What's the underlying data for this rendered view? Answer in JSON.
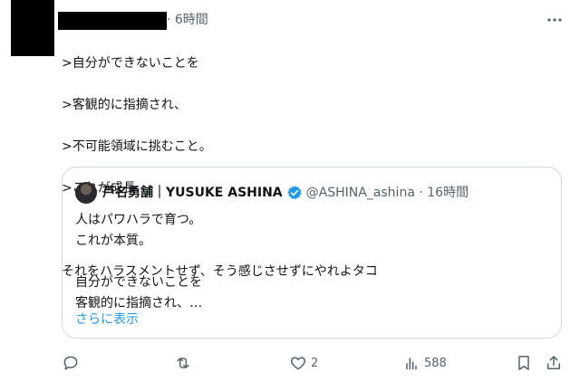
{
  "tweet": {
    "time": "· 6時間",
    "lines": [
      ">自分ができないことを",
      ">客観的に指摘され、",
      ">不可能領域に挑むこと。",
      ">これが成長",
      "",
      "それをハラスメントせず、そう感じさせずにやれよタコ"
    ]
  },
  "quote": {
    "name": "芦名勇舗｜YUSUKE ASHINA",
    "handle": "@ASHINA_ashina · 16時間",
    "lines": [
      "人はパワハラで育つ。",
      "これが本質。",
      "",
      "自分ができないことを",
      "客観的に指摘され、…"
    ],
    "show_more": "さらに表示"
  },
  "actions": {
    "reply_icon": "reply-icon",
    "retweet_icon": "retweet-icon",
    "like_count": "2",
    "views_count": "588"
  },
  "colors": {
    "text": "#0f1419",
    "muted": "#536471",
    "accent": "#1d9bf0",
    "border": "#cfd9de"
  }
}
